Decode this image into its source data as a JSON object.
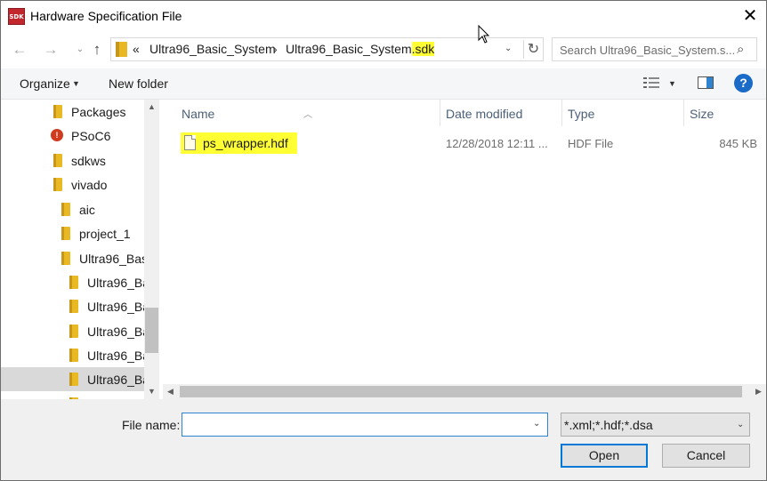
{
  "window": {
    "app_icon_text": "SDK",
    "title": "Hardware Specification File",
    "close_glyph": "✕"
  },
  "address": {
    "overflow": "«",
    "segments": [
      "Ultra96_Basic_System",
      "Ultra96_Basic_System"
    ],
    "last_segment_highlight": ".sdk",
    "separator": "›"
  },
  "search": {
    "placeholder": "Search Ultra96_Basic_System.s..."
  },
  "toolbar": {
    "organize": "Organize",
    "new_folder": "New folder",
    "help": "?"
  },
  "nav_pane": {
    "items": [
      {
        "label": "Packages",
        "icon": "folder-icon"
      },
      {
        "label": "PSoC6",
        "icon": "psoc-icon"
      },
      {
        "label": "sdkws",
        "icon": "folder-icon"
      },
      {
        "label": "vivado",
        "icon": "folder-icon"
      },
      {
        "label": "aic",
        "icon": "folder-icon"
      },
      {
        "label": "project_1",
        "icon": "folder-icon"
      },
      {
        "label": "Ultra96_Basi",
        "icon": "folder-icon"
      },
      {
        "label": "Ultra96_Ba",
        "icon": "folder-icon"
      },
      {
        "label": "Ultra96_Ba",
        "icon": "folder-icon"
      },
      {
        "label": "Ultra96_Ba",
        "icon": "folder-icon"
      },
      {
        "label": "Ultra96_Ba",
        "icon": "folder-icon"
      },
      {
        "label": "Ultra96_Ba",
        "icon": "folder-icon",
        "selected": true
      }
    ]
  },
  "columns": {
    "name": "Name",
    "date": "Date modified",
    "type": "Type",
    "size": "Size"
  },
  "files": [
    {
      "name": "ps_wrapper.hdf",
      "date": "12/28/2018 12:11 ...",
      "type": "HDF File",
      "size": "845 KB"
    }
  ],
  "bottom": {
    "file_name_label": "File name:",
    "file_name_value": "",
    "filter": "*.xml;*.hdf;*.dsa",
    "open": "Open",
    "cancel": "Cancel"
  },
  "colors": {
    "highlight": "#ffff33",
    "accent": "#0078d7",
    "folder": "#e8b923"
  }
}
